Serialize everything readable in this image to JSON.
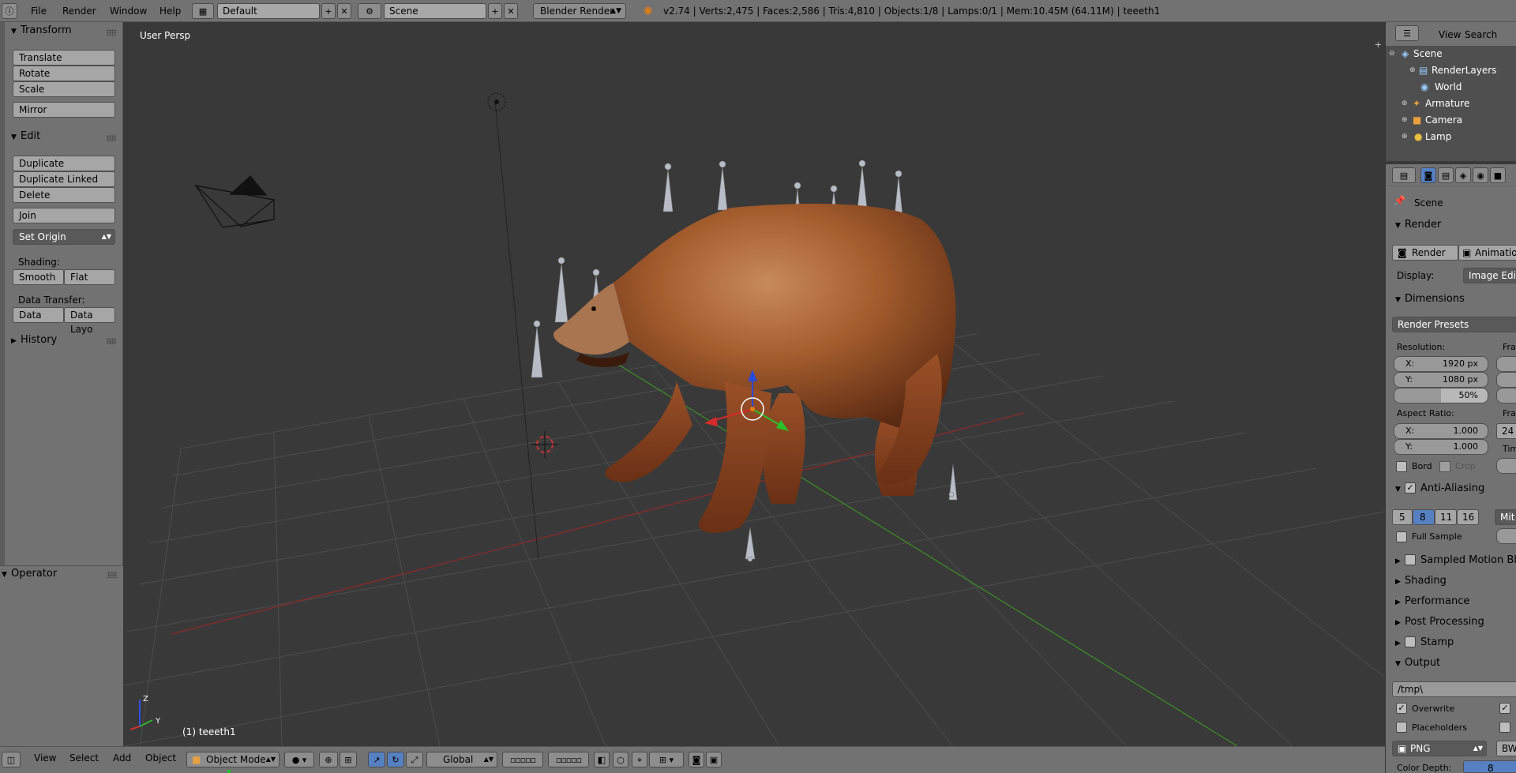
{
  "menubar": {
    "items": [
      "File",
      "Render",
      "Window",
      "Help"
    ],
    "screen_layout": "Default",
    "scene": "Scene",
    "render_engine": "Blender Render",
    "stats": "v2.74 | Verts:2,475 | Faces:2,586 | Tris:4,810 | Objects:1/8 | Lamps:0/1 | Mem:10.45M (64.11M) | teeeth1"
  },
  "toolshelf": {
    "transform": {
      "title": "Transform",
      "buttons": [
        "Translate",
        "Rotate",
        "Scale",
        "Mirror"
      ]
    },
    "edit": {
      "title": "Edit",
      "buttons": [
        "Duplicate",
        "Duplicate Linked",
        "Delete",
        "Join"
      ],
      "set_origin": "Set Origin"
    },
    "shading": {
      "label": "Shading:",
      "smooth": "Smooth",
      "flat": "Flat"
    },
    "data_transfer": {
      "label": "Data Transfer:",
      "data": "Data",
      "data_layout": "Data Layo"
    },
    "history": {
      "title": "History"
    },
    "operator": {
      "title": "Operator"
    }
  },
  "viewport": {
    "view_label": "User Persp",
    "object_label": "(1) teeeth1",
    "axis_z": "Z",
    "axis_y": "Y"
  },
  "bottombar": {
    "items": [
      "View",
      "Select",
      "Add",
      "Object"
    ],
    "mode": "Object Mode",
    "orientation": "Global"
  },
  "outliner": {
    "menu": [
      "View",
      "Search"
    ],
    "rows": [
      "Scene",
      "RenderLayers",
      "World",
      "Armature",
      "Camera",
      "Lamp"
    ]
  },
  "properties": {
    "context": "Scene",
    "render": {
      "title": "Render",
      "render_btn": "Render",
      "animation_btn": "Animation",
      "display_label": "Display:",
      "display_value": "Image Edito"
    },
    "dimensions": {
      "title": "Dimensions",
      "presets": "Render Presets",
      "resolution_label": "Resolution:",
      "res_x_label": "X:",
      "res_x": "1920 px",
      "res_y_label": "Y:",
      "res_y": "1080 px",
      "res_pct": "50%",
      "frame_label": "Fra",
      "aspect_label": "Aspect Ratio:",
      "asp_x_label": "X:",
      "asp_x": "1.000",
      "asp_y_label": "Y:",
      "asp_y": "1.000",
      "fps_label": "Fra",
      "fps_value": "24",
      "time_label": "Tim",
      "border": "Bord",
      "crop": "Crop"
    },
    "anti_aliasing": {
      "title": "Anti-Aliasing",
      "samples": [
        "5",
        "8",
        "11",
        "16"
      ],
      "selected": "8",
      "filter": "Mit",
      "full_sample": "Full Sample"
    },
    "panels": [
      "Sampled Motion Blu",
      "Shading",
      "Performance",
      "Post Processing",
      "Stamp"
    ],
    "output": {
      "title": "Output",
      "path": "/tmp\\",
      "overwrite": "Overwrite",
      "placeholders": "Placeholders",
      "format": "PNG",
      "bw": "BW",
      "color_depth_label": "Color Depth:",
      "color_depth": "8"
    }
  },
  "colors": {
    "accent_blue": "#5680c2",
    "header_gray": "#727272",
    "viewport_bg": "#393939"
  }
}
